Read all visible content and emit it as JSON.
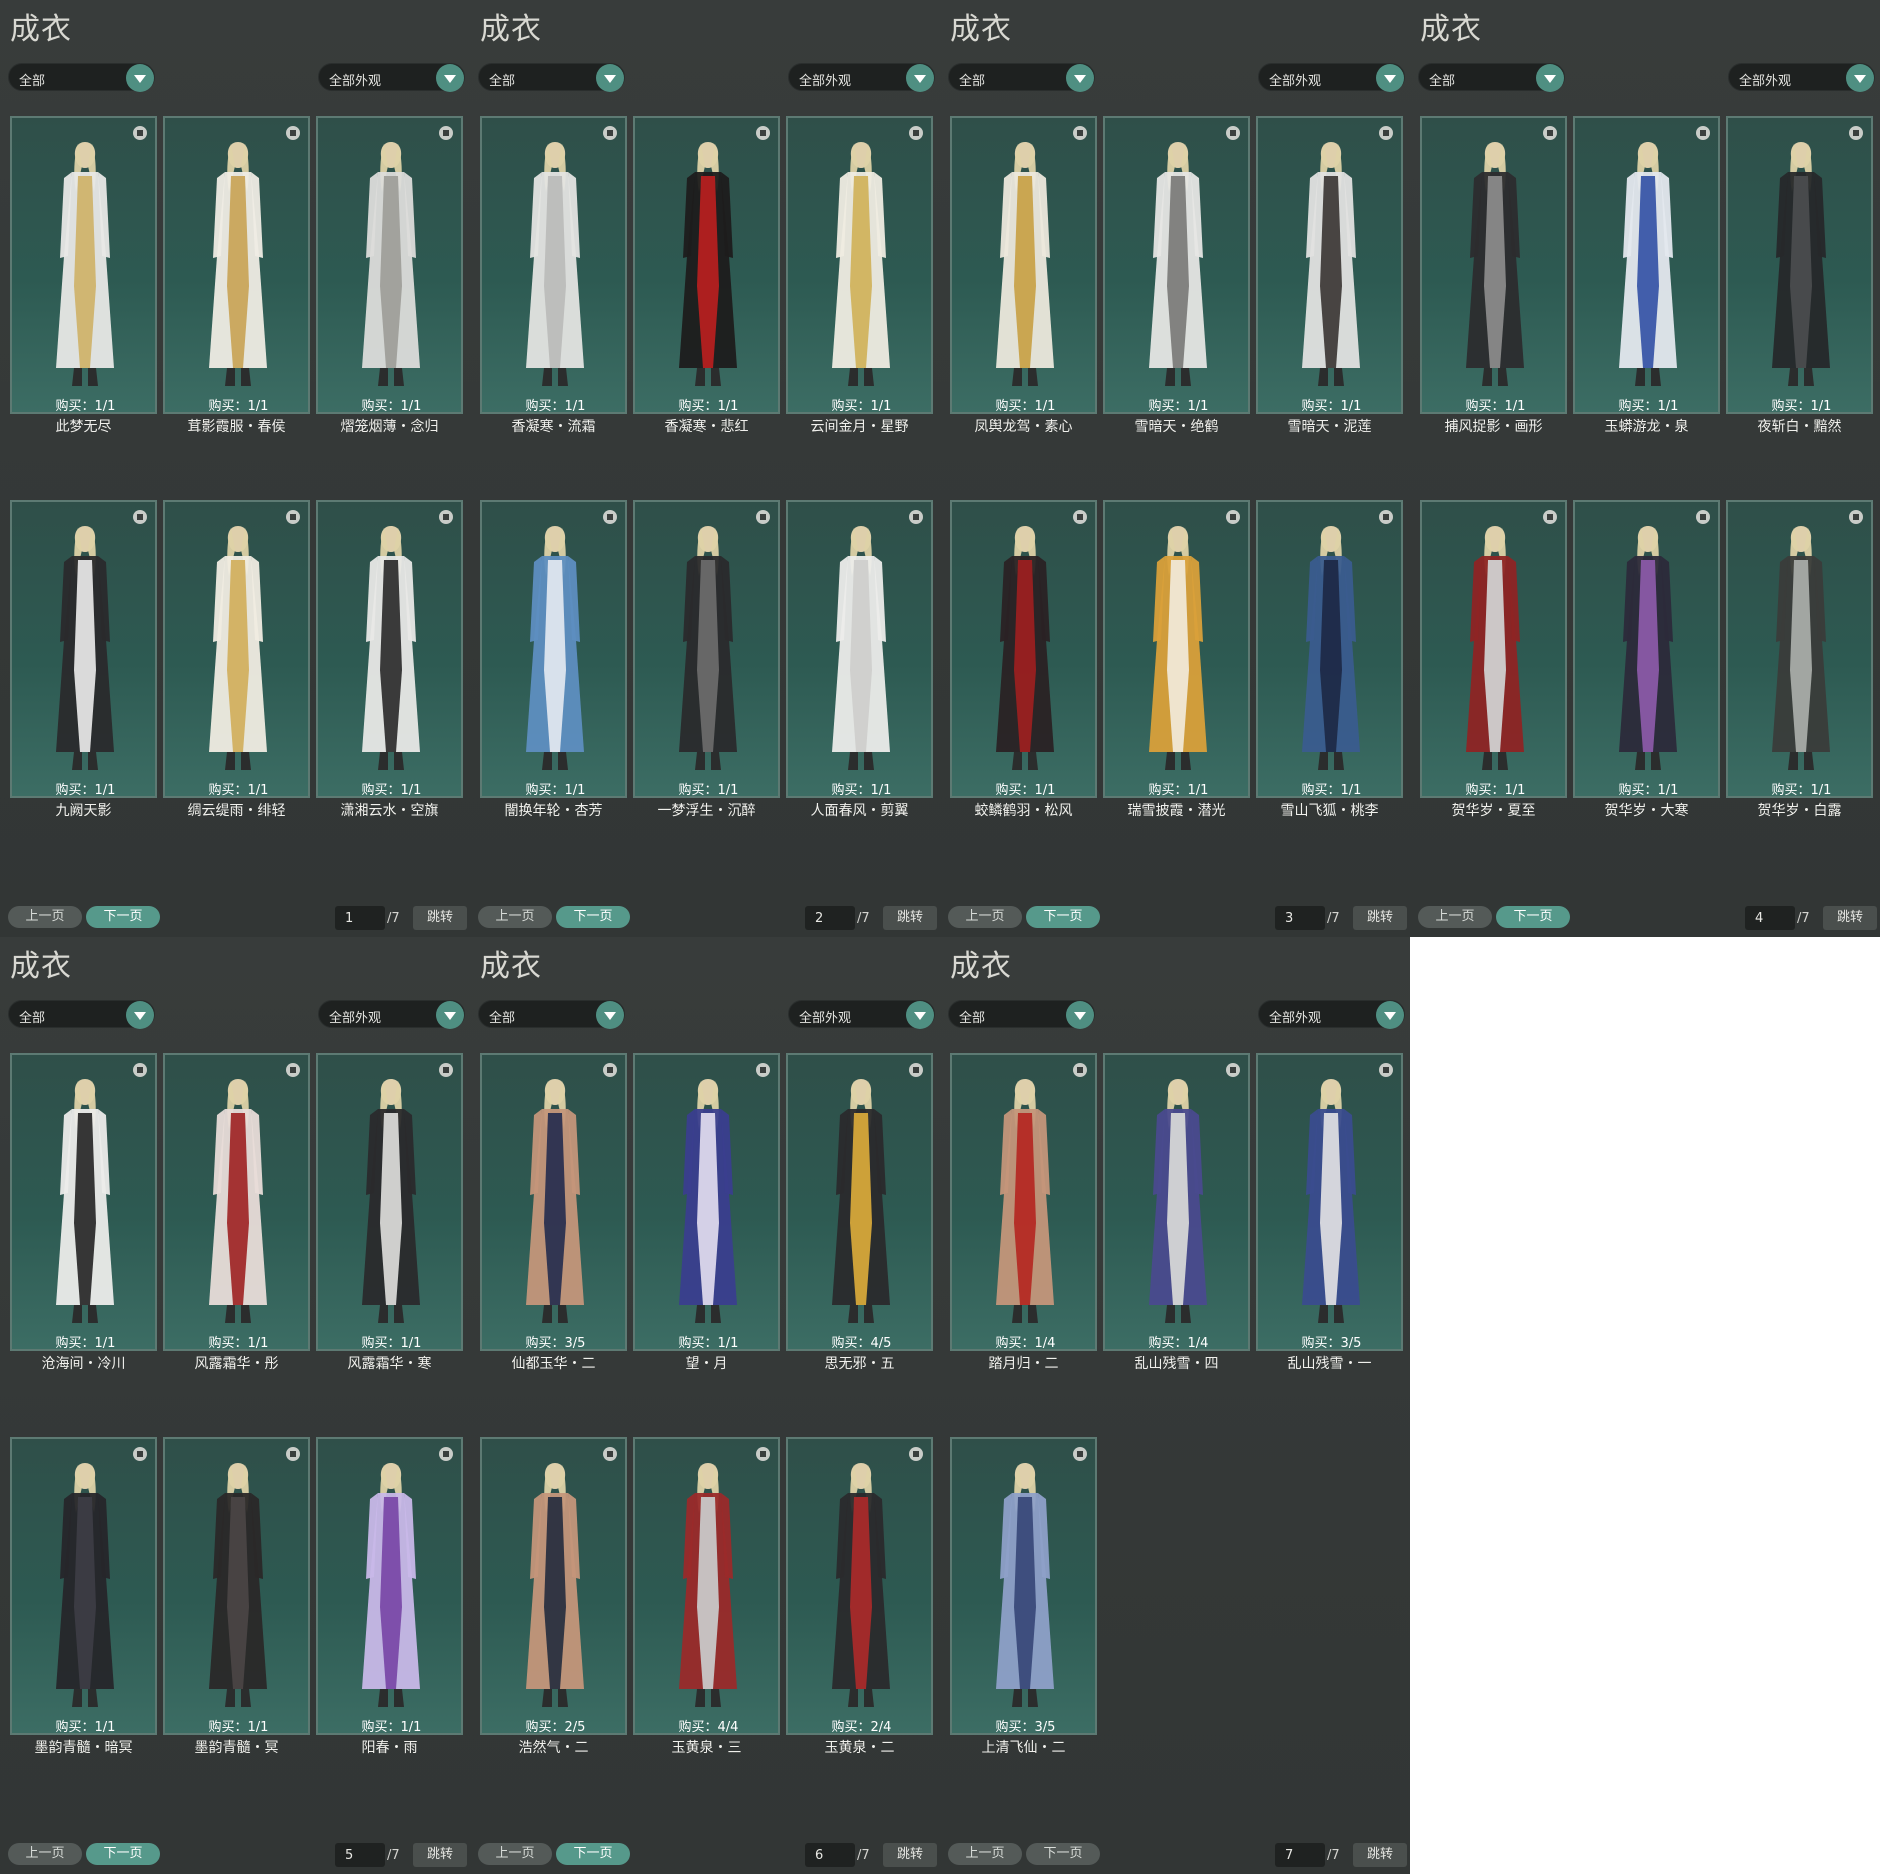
{
  "panels": [
    {
      "title": "成衣",
      "category": "全部",
      "appearance": "全部外观",
      "page": "1",
      "total": "/7",
      "prev": "上一页",
      "next": "下一页",
      "jump": "跳转",
      "items": [
        {
          "name": "此梦无尽",
          "buy": "购买：1/1",
          "colors": [
            "#e8e8e6",
            "#cfb36c"
          ]
        },
        {
          "name": "茸影霞服・春侯",
          "buy": "购买：1/1",
          "colors": [
            "#efece4",
            "#c9a55a"
          ]
        },
        {
          "name": "熠笼烟薄・念归",
          "buy": "购买：1/1",
          "colors": [
            "#dcdcda",
            "#9f9f9a"
          ]
        },
        {
          "name": "凤舆龙驾・素心",
          "buy": "购买：1/1",
          "colors": [
            "#ece8dc",
            "#c8a24a"
          ]
        },
        {
          "name": "雪暗天・绝鹤",
          "buy": "购买：1/1",
          "colors": [
            "#e6e6e4",
            "#7c7c7a"
          ]
        },
        {
          "name": "雪暗天・泥莲",
          "buy": "购买：1/1",
          "colors": [
            "#e2e2e0",
            "#403c3a"
          ]
        },
        {
          "name": "九阙天影",
          "buy": "购买：1/1",
          "colors": [
            "#2a2a2c",
            "#e4e4e4"
          ]
        },
        {
          "name": "绸云缇雨・绯轻",
          "buy": "购买：1/1",
          "colors": [
            "#f0ece2",
            "#d2b060"
          ]
        },
        {
          "name": "潇湘云水・空旗",
          "buy": "购买：1/1",
          "colors": [
            "#e8e8e6",
            "#303030"
          ]
        }
      ]
    }
  ]
}
